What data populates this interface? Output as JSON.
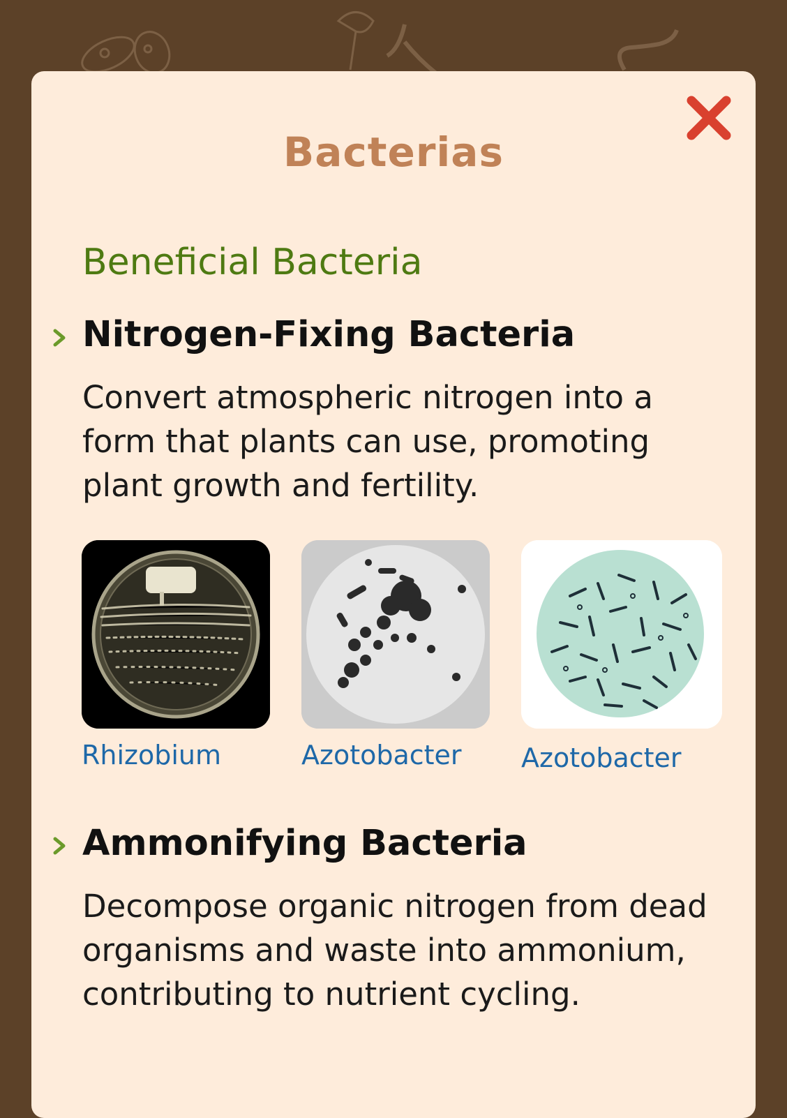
{
  "modal": {
    "title": "Bacterias",
    "close_icon": "close-x-icon",
    "section_heading": "Beneficial Bacteria",
    "items": [
      {
        "title": "Nitrogen-Fixing Bacteria",
        "description": "Convert atmospheric nitrogen into a form that plants can use, promoting plant growth and fertility.",
        "images": [
          {
            "label": "Rhizobium",
            "icon": "petri-dish-image"
          },
          {
            "label": "Azotobacter",
            "icon": "microscope-cells-image"
          },
          {
            "label": "Azotobacter",
            "icon": "rod-bacteria-image"
          }
        ]
      },
      {
        "title": "Ammonifying Bacteria",
        "description": "Decompose organic nitrogen from dead organisms and waste into ammonium, contributing to nutrient cycling."
      }
    ]
  },
  "colors": {
    "background": "#5c4128",
    "modal_bg": "#feecdb",
    "title": "#c08257",
    "section_heading": "#4e7a12",
    "link": "#1e68a8",
    "close": "#d9412f",
    "chevron": "#6b9a2a"
  }
}
